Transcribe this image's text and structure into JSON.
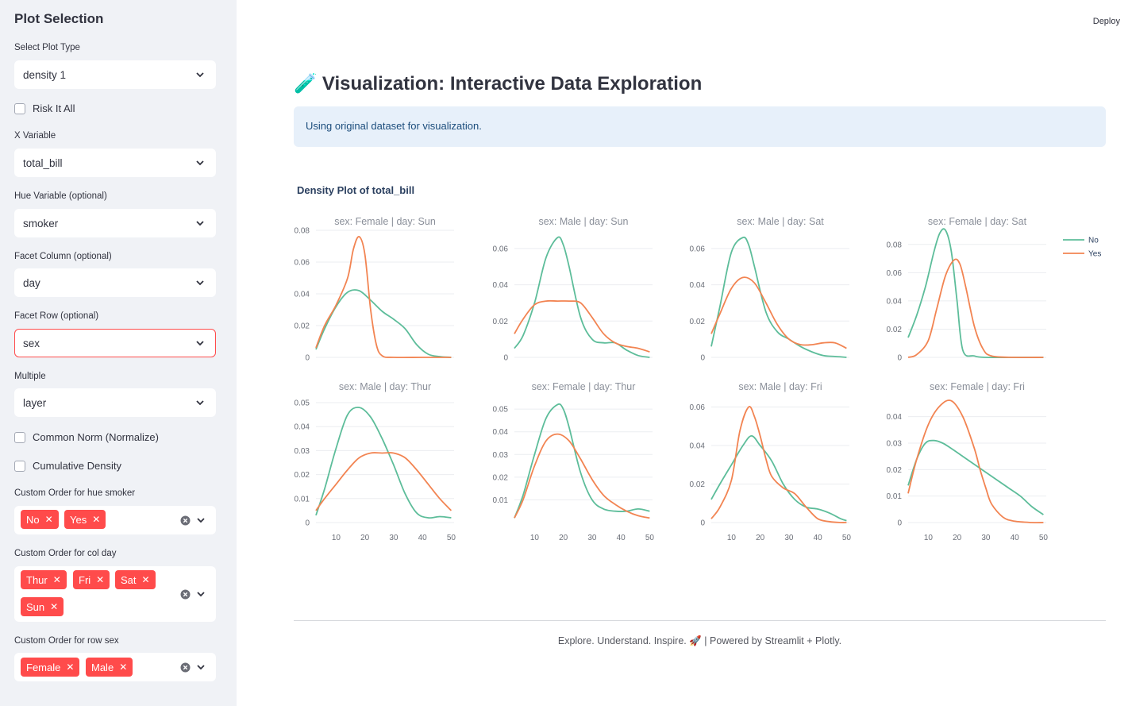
{
  "sidebar": {
    "title": "Plot Selection",
    "plot_type_label": "Select Plot Type",
    "plot_type_value": "density 1",
    "risk_label": "Risk It All",
    "x_label": "X Variable",
    "x_value": "total_bill",
    "hue_label": "Hue Variable (optional)",
    "hue_value": "smoker",
    "facet_col_label": "Facet Column (optional)",
    "facet_col_value": "day",
    "facet_row_label": "Facet Row (optional)",
    "facet_row_value": "sex",
    "multiple_label": "Multiple",
    "multiple_value": "layer",
    "common_norm_label": "Common Norm (Normalize)",
    "cumulative_label": "Cumulative Density",
    "order_hue_label": "Custom Order for hue smoker",
    "order_hue_tags": [
      "No",
      "Yes"
    ],
    "order_col_label": "Custom Order for col day",
    "order_col_tags": [
      "Thur",
      "Fri",
      "Sat",
      "Sun"
    ],
    "order_row_label": "Custom Order for row sex",
    "order_row_tags": [
      "Female",
      "Male"
    ]
  },
  "header": {
    "deploy_label": "Deploy"
  },
  "main": {
    "title_icon": "🧪",
    "title": "Visualization: Interactive Data Exploration",
    "info": "Using original dataset for visualization.",
    "footer": "Explore. Understand. Inspire. 🚀 | Powered by Streamlit + Plotly."
  },
  "colors": {
    "No": "#5dbd9a",
    "Yes": "#f28452",
    "accent": "#ff4b4b"
  },
  "chart_data": {
    "type": "line",
    "title": "Density Plot of total_bill",
    "legend": [
      "No",
      "Yes"
    ],
    "legend_position": "top-right",
    "x_ticks": [
      10,
      20,
      30,
      40,
      50
    ],
    "xlim": [
      3,
      51
    ],
    "facets": [
      {
        "title": "sex: Female | day: Sun",
        "ylim": [
          0,
          0.08
        ],
        "yticks": [
          0,
          0.02,
          0.04,
          0.06,
          0.08
        ],
        "series": [
          {
            "name": "No",
            "x": [
              3,
              6,
              10,
              14,
              18,
              22,
              26,
              30,
              34,
              38,
              42,
              46,
              50
            ],
            "y": [
              0.005,
              0.018,
              0.032,
              0.041,
              0.042,
              0.036,
              0.029,
              0.024,
              0.018,
              0.008,
              0.002,
              0.0005,
              0
            ]
          },
          {
            "name": "Yes",
            "x": [
              3,
              6,
              10,
              14,
              16,
              18,
              20,
              22,
              24,
              26,
              30,
              40,
              50
            ],
            "y": [
              0.006,
              0.02,
              0.033,
              0.05,
              0.068,
              0.076,
              0.065,
              0.03,
              0.008,
              0.001,
              0,
              0,
              0
            ]
          }
        ]
      },
      {
        "title": "sex: Male | day: Sun",
        "ylim": [
          0,
          0.07
        ],
        "yticks": [
          0,
          0.02,
          0.04,
          0.06
        ],
        "series": [
          {
            "name": "No",
            "x": [
              3,
              6,
              10,
              14,
              18,
              20,
              22,
              26,
              30,
              34,
              38,
              42,
              46,
              50
            ],
            "y": [
              0.005,
              0.012,
              0.03,
              0.055,
              0.066,
              0.062,
              0.05,
              0.022,
              0.01,
              0.008,
              0.008,
              0.004,
              0.001,
              0
            ]
          },
          {
            "name": "Yes",
            "x": [
              3,
              6,
              10,
              14,
              18,
              22,
              26,
              30,
              34,
              38,
              42,
              46,
              50
            ],
            "y": [
              0.013,
              0.021,
              0.029,
              0.031,
              0.031,
              0.031,
              0.03,
              0.022,
              0.013,
              0.008,
              0.006,
              0.005,
              0.003
            ]
          }
        ]
      },
      {
        "title": "sex: Male | day: Sat",
        "ylim": [
          0,
          0.07
        ],
        "yticks": [
          0,
          0.02,
          0.04,
          0.06
        ],
        "series": [
          {
            "name": "No",
            "x": [
              3,
              6,
              10,
              14,
              16,
              18,
              22,
              26,
              30,
              34,
              38,
              42,
              46,
              50
            ],
            "y": [
              0.006,
              0.028,
              0.058,
              0.066,
              0.062,
              0.05,
              0.025,
              0.014,
              0.01,
              0.006,
              0.003,
              0.001,
              0.0005,
              0
            ]
          },
          {
            "name": "Yes",
            "x": [
              3,
              6,
              10,
              14,
              18,
              22,
              26,
              30,
              34,
              38,
              42,
              46,
              50
            ],
            "y": [
              0.013,
              0.024,
              0.038,
              0.044,
              0.041,
              0.03,
              0.018,
              0.01,
              0.007,
              0.007,
              0.008,
              0.008,
              0.005
            ]
          }
        ]
      },
      {
        "title": "sex: Female | day: Sat",
        "ylim": [
          0,
          0.09
        ],
        "yticks": [
          0,
          0.02,
          0.04,
          0.06,
          0.08
        ],
        "series": [
          {
            "name": "No",
            "x": [
              3,
              6,
              9,
              12,
              14,
              16,
              18,
              20,
              22,
              26,
              30,
              40,
              50
            ],
            "y": [
              0.014,
              0.03,
              0.05,
              0.075,
              0.088,
              0.09,
              0.075,
              0.04,
              0.005,
              0.001,
              0,
              0,
              0
            ]
          },
          {
            "name": "Yes",
            "x": [
              3,
              6,
              10,
              13,
              16,
              19,
              21,
              23,
              26,
              29,
              32,
              40,
              50
            ],
            "y": [
              0,
              0.002,
              0.012,
              0.035,
              0.058,
              0.069,
              0.066,
              0.05,
              0.022,
              0.006,
              0.001,
              0,
              0
            ]
          }
        ]
      },
      {
        "title": "sex: Male | day: Thur",
        "ylim": [
          0,
          0.053
        ],
        "yticks": [
          0,
          0.01,
          0.02,
          0.03,
          0.04,
          0.05
        ],
        "series": [
          {
            "name": "No",
            "x": [
              3,
              6,
              10,
              14,
              18,
              22,
              26,
              30,
              34,
              38,
              42,
              46,
              50
            ],
            "y": [
              0.003,
              0.014,
              0.031,
              0.045,
              0.048,
              0.044,
              0.035,
              0.024,
              0.012,
              0.004,
              0.002,
              0.0025,
              0.002
            ]
          },
          {
            "name": "Yes",
            "x": [
              3,
              6,
              10,
              14,
              18,
              22,
              26,
              30,
              34,
              38,
              42,
              46,
              50
            ],
            "y": [
              0.005,
              0.01,
              0.016,
              0.022,
              0.027,
              0.029,
              0.029,
              0.029,
              0.027,
              0.022,
              0.016,
              0.01,
              0.005
            ]
          }
        ]
      },
      {
        "title": "sex: Female | day: Thur",
        "ylim": [
          0,
          0.056
        ],
        "yticks": [
          0.01,
          0.02,
          0.03,
          0.04,
          0.05
        ],
        "series": [
          {
            "name": "No",
            "x": [
              3,
              6,
              10,
              14,
              18,
              20,
              22,
              26,
              30,
              34,
              38,
              42,
              46,
              50
            ],
            "y": [
              0.002,
              0.012,
              0.03,
              0.046,
              0.052,
              0.05,
              0.042,
              0.022,
              0.01,
              0.006,
              0.005,
              0.005,
              0.006,
              0.005
            ]
          },
          {
            "name": "Yes",
            "x": [
              3,
              6,
              10,
              14,
              18,
              22,
              26,
              30,
              34,
              38,
              42,
              46,
              50
            ],
            "y": [
              0.002,
              0.01,
              0.025,
              0.036,
              0.039,
              0.036,
              0.028,
              0.019,
              0.012,
              0.008,
              0.005,
              0.003,
              0.002
            ]
          }
        ]
      },
      {
        "title": "sex: Male | day: Fri",
        "ylim": [
          0,
          0.066
        ],
        "yticks": [
          0,
          0.02,
          0.04,
          0.06
        ],
        "series": [
          {
            "name": "No",
            "x": [
              3,
              6,
              10,
              14,
              17,
              20,
              24,
              28,
              32,
              36,
              40,
              44,
              48,
              50
            ],
            "y": [
              0.012,
              0.02,
              0.03,
              0.04,
              0.045,
              0.04,
              0.032,
              0.02,
              0.012,
              0.008,
              0.007,
              0.005,
              0.002,
              0.001
            ]
          },
          {
            "name": "Yes",
            "x": [
              3,
              6,
              10,
              13,
              16,
              18,
              20,
              22,
              24,
              28,
              32,
              36,
              40,
              44,
              48,
              50
            ],
            "y": [
              0.002,
              0.008,
              0.022,
              0.048,
              0.06,
              0.055,
              0.045,
              0.033,
              0.024,
              0.018,
              0.015,
              0.008,
              0.002,
              0.0005,
              0,
              0
            ]
          }
        ]
      },
      {
        "title": "sex: Female | day: Fri",
        "ylim": [
          0,
          0.048
        ],
        "yticks": [
          0,
          0.01,
          0.02,
          0.03,
          0.04
        ],
        "series": [
          {
            "name": "No",
            "x": [
              3,
              6,
              9,
              12,
              15,
              18,
              22,
              26,
              30,
              34,
              38,
              42,
              46,
              50
            ],
            "y": [
              0.014,
              0.024,
              0.03,
              0.031,
              0.03,
              0.028,
              0.025,
              0.022,
              0.019,
              0.016,
              0.013,
              0.01,
              0.006,
              0.003
            ]
          },
          {
            "name": "Yes",
            "x": [
              3,
              6,
              10,
              14,
              18,
              22,
              26,
              28,
              30,
              32,
              36,
              40,
              46,
              50
            ],
            "y": [
              0.011,
              0.024,
              0.037,
              0.044,
              0.046,
              0.04,
              0.028,
              0.02,
              0.013,
              0.007,
              0.002,
              0.0005,
              0,
              0
            ]
          }
        ]
      }
    ]
  }
}
